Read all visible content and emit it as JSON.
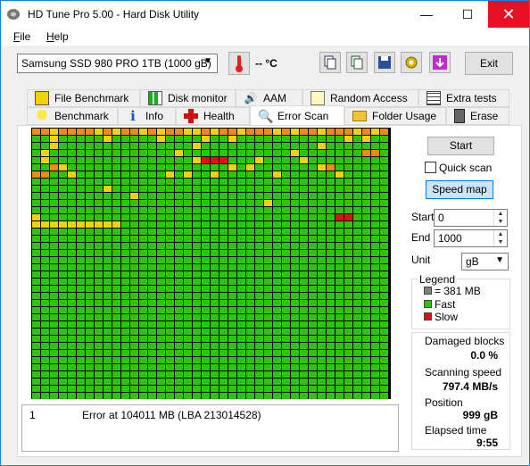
{
  "window": {
    "title": "HD Tune Pro 5.00 - Hard Disk Utility",
    "min_symbol": "—",
    "max_symbol": "☐",
    "close_symbol": "✕"
  },
  "menu": [
    "File",
    "Help"
  ],
  "toolbar": {
    "drive": "Samsung SSD 980 PRO 1TB (1000 gB)",
    "temperature": "-- °C",
    "exit_label": "Exit"
  },
  "tabs_row1": [
    "File Benchmark",
    "Disk monitor",
    "AAM",
    "Random Access",
    "Extra tests"
  ],
  "tabs_row2": [
    "Benchmark",
    "Info",
    "Health",
    "Error Scan",
    "Folder Usage",
    "Erase"
  ],
  "controls": {
    "start_label": "Start",
    "quick_scan_label": "Quick scan",
    "speed_map_label": "Speed map",
    "start_field_label": "Start",
    "start_value": "0",
    "end_field_label": "End",
    "end_value": "1000",
    "unit_label": "Unit",
    "unit_value": "gB"
  },
  "legend": {
    "title": "Legend",
    "block_size": "= 381 MB",
    "fast": "Fast",
    "slow": "Slow",
    "colors": {
      "block": "#808080",
      "fast": "#2ec40c",
      "slow": "#e01010",
      "medium": "#f2d00a",
      "mediumslow": "#f08a10"
    }
  },
  "stats": {
    "damaged_label": "Damaged blocks",
    "damaged_value": "0.0 %",
    "speed_label": "Scanning speed",
    "speed_value": "797.4 MB/s",
    "position_label": "Position",
    "position_value": "999 gB",
    "elapsed_label": "Elapsed time",
    "elapsed_value": "9:55"
  },
  "log": [
    {
      "index": "1",
      "message": "Error at 104011 MB (LBA 213014528)"
    }
  ],
  "scan_map": {
    "columns": 40,
    "rows": 38,
    "rows_data": [
      "MMYOOMOYMYOMYOYMOYYOYOMYMOMYMYOOYMOMYMYM",
      "GGYGGGGGYGGGGGYGGGGYGGYGGGGGGGGGGGGYGYGG",
      "GGYGGGGGGGGGGGGGGGYGGGGGGGGGGGGGYGGGGGGG",
      "GYGGGGGGGGGGGGGGYGGGGGGGGGGGGYGGGGGGGOMG",
      "GYGGGGGGGGGGGGGGGGYSSSGGGYGGGGYGGGGGGGGG",
      "GGOYGGGGGGGGGGGGGGGGGGYGYGGGGGGGYOGGGGGG",
      "OOGGYGGGGGGGGGGYGYGGYGGGGGGYGGGGGGYGGGGG",
      "GGGGGGGGGGGGGGGGGGGGGGGGGGGGGGGGGGGGGGGG",
      "GGGGGGGGYGGGGGGGGGGGGGGGGGGGGGGGGGGGGGGG",
      "GGGGGGGGGGGYGGGGGGGGGGGGGGGGGGGGGGGGGGGG",
      "GGGGGGGGGGGGGGGGGGGGGGGGGGYGGGGGGGGGGGGG",
      "GGGGGGGGGGGGGGGGGGGGGGGGGGGGGGGGGGGGGGGG",
      "YGGGGGGGGGGGGGGGGGGGGGGGGGGGGGGGGGSSGGGG",
      "YYYYYYYYYYGGGGGGGGGGGGGGGGGGGGGGGGGGGGGG",
      "GGGGGGGGGGGGGGGGGGGGGGGGGGGGGGGGGGGGGGGG",
      "GGGGGGGGGGGGGGGGGGGGGGGGGGGGGGGGGGGGGGGG",
      "GGGGGGGGGGGGGGGGGGGGGGGGGGGGGGGGGGGGGGGG",
      "GGGGGGGGGGGGGGGGGGGGGGGGGGGGGGGGGGGGGGGG",
      "GGGGGGGGGGGGGGGGGGGGGGGGGGGGGGGGGGGGGGGG",
      "GGGGGGGGGGGGGGGGGGGGGGGGGGGGGGGGGGGGGGGG",
      "GGGGGGGGGGGGGGGGGGGGGGGGGGGGGGGGGGGGGGGG",
      "GGGGGGGGGGGGGGGGGGGGGGGGGGGGGGGGGGGGGGGG",
      "GGGGGGGGGGGGGGGGGGGGGGGGGGGGGGGGGGGGGGGG",
      "GGGGGGGGGGGGGGGGGGGGGGGGGGGGGGGGGGGGGGGG",
      "GGGGGGGGGGGGGGGGGGGGGGGGGGGGGGGGGGGGGGGG",
      "GGGGGGGGGGGGGGGGGGGGGGGGGGGGGGGGGGGGGGGG",
      "GGGGGGGGGGGGGGGGGGGGGGGGGGGGGGGGGGGGGGGG",
      "GGGGGGGGGGGGGGGGGGGGGGGGGGGGGGGGGGGGGGGG",
      "GGGGGGGGGGGGGGGGGGGGGGGGGGGGGGGGGGGGGGGG",
      "GGGGGGGGGGGGGGGGGGGGGGGGGGGGGGGGGGGGGGGG",
      "GGGGGGGGGGGGGGGGGGGGGGGGGGGGGGGGGGGGGGGG",
      "GGGGGGGGGGGGGGGGGGGGGGGGGGGGGGGGGGGGGGGG",
      "GGGGGGGGGGGGGGGGGGGGGGGGGGGGGGGGGGGGGGGG",
      "GGGGGGGGGGGGGGGGGGGGGGGGGGGGGGGGGGGGGGGG",
      "GGGGGGGGGGGGGGGGGGGGGGGGGGGGGGGGGGGGGGGG",
      "GGGGGGGGGGGGGGGGGGGGGGGGGGGGGGGGGGGGGGGG",
      "GGGGGGGGGGGGGGGGGGGGGGGGGGGGGGGGGGGGGGGG",
      "GGGGGGGGGGGGGGGGGGGGGGGGGGGGGGGGGGGGGGGG"
    ]
  }
}
